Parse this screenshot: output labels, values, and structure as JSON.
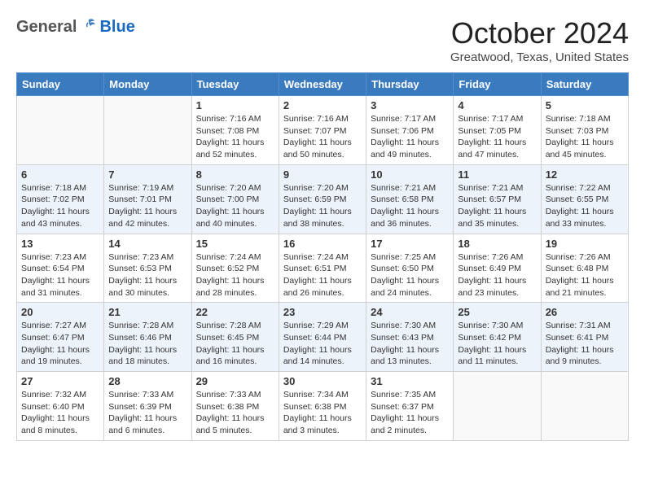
{
  "header": {
    "logo_general": "General",
    "logo_blue": "Blue",
    "month_title": "October 2024",
    "location": "Greatwood, Texas, United States"
  },
  "days_of_week": [
    "Sunday",
    "Monday",
    "Tuesday",
    "Wednesday",
    "Thursday",
    "Friday",
    "Saturday"
  ],
  "weeks": [
    [
      {
        "day": "",
        "detail": ""
      },
      {
        "day": "",
        "detail": ""
      },
      {
        "day": "1",
        "detail": "Sunrise: 7:16 AM\nSunset: 7:08 PM\nDaylight: 11 hours and 52 minutes."
      },
      {
        "day": "2",
        "detail": "Sunrise: 7:16 AM\nSunset: 7:07 PM\nDaylight: 11 hours and 50 minutes."
      },
      {
        "day": "3",
        "detail": "Sunrise: 7:17 AM\nSunset: 7:06 PM\nDaylight: 11 hours and 49 minutes."
      },
      {
        "day": "4",
        "detail": "Sunrise: 7:17 AM\nSunset: 7:05 PM\nDaylight: 11 hours and 47 minutes."
      },
      {
        "day": "5",
        "detail": "Sunrise: 7:18 AM\nSunset: 7:03 PM\nDaylight: 11 hours and 45 minutes."
      }
    ],
    [
      {
        "day": "6",
        "detail": "Sunrise: 7:18 AM\nSunset: 7:02 PM\nDaylight: 11 hours and 43 minutes."
      },
      {
        "day": "7",
        "detail": "Sunrise: 7:19 AM\nSunset: 7:01 PM\nDaylight: 11 hours and 42 minutes."
      },
      {
        "day": "8",
        "detail": "Sunrise: 7:20 AM\nSunset: 7:00 PM\nDaylight: 11 hours and 40 minutes."
      },
      {
        "day": "9",
        "detail": "Sunrise: 7:20 AM\nSunset: 6:59 PM\nDaylight: 11 hours and 38 minutes."
      },
      {
        "day": "10",
        "detail": "Sunrise: 7:21 AM\nSunset: 6:58 PM\nDaylight: 11 hours and 36 minutes."
      },
      {
        "day": "11",
        "detail": "Sunrise: 7:21 AM\nSunset: 6:57 PM\nDaylight: 11 hours and 35 minutes."
      },
      {
        "day": "12",
        "detail": "Sunrise: 7:22 AM\nSunset: 6:55 PM\nDaylight: 11 hours and 33 minutes."
      }
    ],
    [
      {
        "day": "13",
        "detail": "Sunrise: 7:23 AM\nSunset: 6:54 PM\nDaylight: 11 hours and 31 minutes."
      },
      {
        "day": "14",
        "detail": "Sunrise: 7:23 AM\nSunset: 6:53 PM\nDaylight: 11 hours and 30 minutes."
      },
      {
        "day": "15",
        "detail": "Sunrise: 7:24 AM\nSunset: 6:52 PM\nDaylight: 11 hours and 28 minutes."
      },
      {
        "day": "16",
        "detail": "Sunrise: 7:24 AM\nSunset: 6:51 PM\nDaylight: 11 hours and 26 minutes."
      },
      {
        "day": "17",
        "detail": "Sunrise: 7:25 AM\nSunset: 6:50 PM\nDaylight: 11 hours and 24 minutes."
      },
      {
        "day": "18",
        "detail": "Sunrise: 7:26 AM\nSunset: 6:49 PM\nDaylight: 11 hours and 23 minutes."
      },
      {
        "day": "19",
        "detail": "Sunrise: 7:26 AM\nSunset: 6:48 PM\nDaylight: 11 hours and 21 minutes."
      }
    ],
    [
      {
        "day": "20",
        "detail": "Sunrise: 7:27 AM\nSunset: 6:47 PM\nDaylight: 11 hours and 19 minutes."
      },
      {
        "day": "21",
        "detail": "Sunrise: 7:28 AM\nSunset: 6:46 PM\nDaylight: 11 hours and 18 minutes."
      },
      {
        "day": "22",
        "detail": "Sunrise: 7:28 AM\nSunset: 6:45 PM\nDaylight: 11 hours and 16 minutes."
      },
      {
        "day": "23",
        "detail": "Sunrise: 7:29 AM\nSunset: 6:44 PM\nDaylight: 11 hours and 14 minutes."
      },
      {
        "day": "24",
        "detail": "Sunrise: 7:30 AM\nSunset: 6:43 PM\nDaylight: 11 hours and 13 minutes."
      },
      {
        "day": "25",
        "detail": "Sunrise: 7:30 AM\nSunset: 6:42 PM\nDaylight: 11 hours and 11 minutes."
      },
      {
        "day": "26",
        "detail": "Sunrise: 7:31 AM\nSunset: 6:41 PM\nDaylight: 11 hours and 9 minutes."
      }
    ],
    [
      {
        "day": "27",
        "detail": "Sunrise: 7:32 AM\nSunset: 6:40 PM\nDaylight: 11 hours and 8 minutes."
      },
      {
        "day": "28",
        "detail": "Sunrise: 7:33 AM\nSunset: 6:39 PM\nDaylight: 11 hours and 6 minutes."
      },
      {
        "day": "29",
        "detail": "Sunrise: 7:33 AM\nSunset: 6:38 PM\nDaylight: 11 hours and 5 minutes."
      },
      {
        "day": "30",
        "detail": "Sunrise: 7:34 AM\nSunset: 6:38 PM\nDaylight: 11 hours and 3 minutes."
      },
      {
        "day": "31",
        "detail": "Sunrise: 7:35 AM\nSunset: 6:37 PM\nDaylight: 11 hours and 2 minutes."
      },
      {
        "day": "",
        "detail": ""
      },
      {
        "day": "",
        "detail": ""
      }
    ]
  ]
}
